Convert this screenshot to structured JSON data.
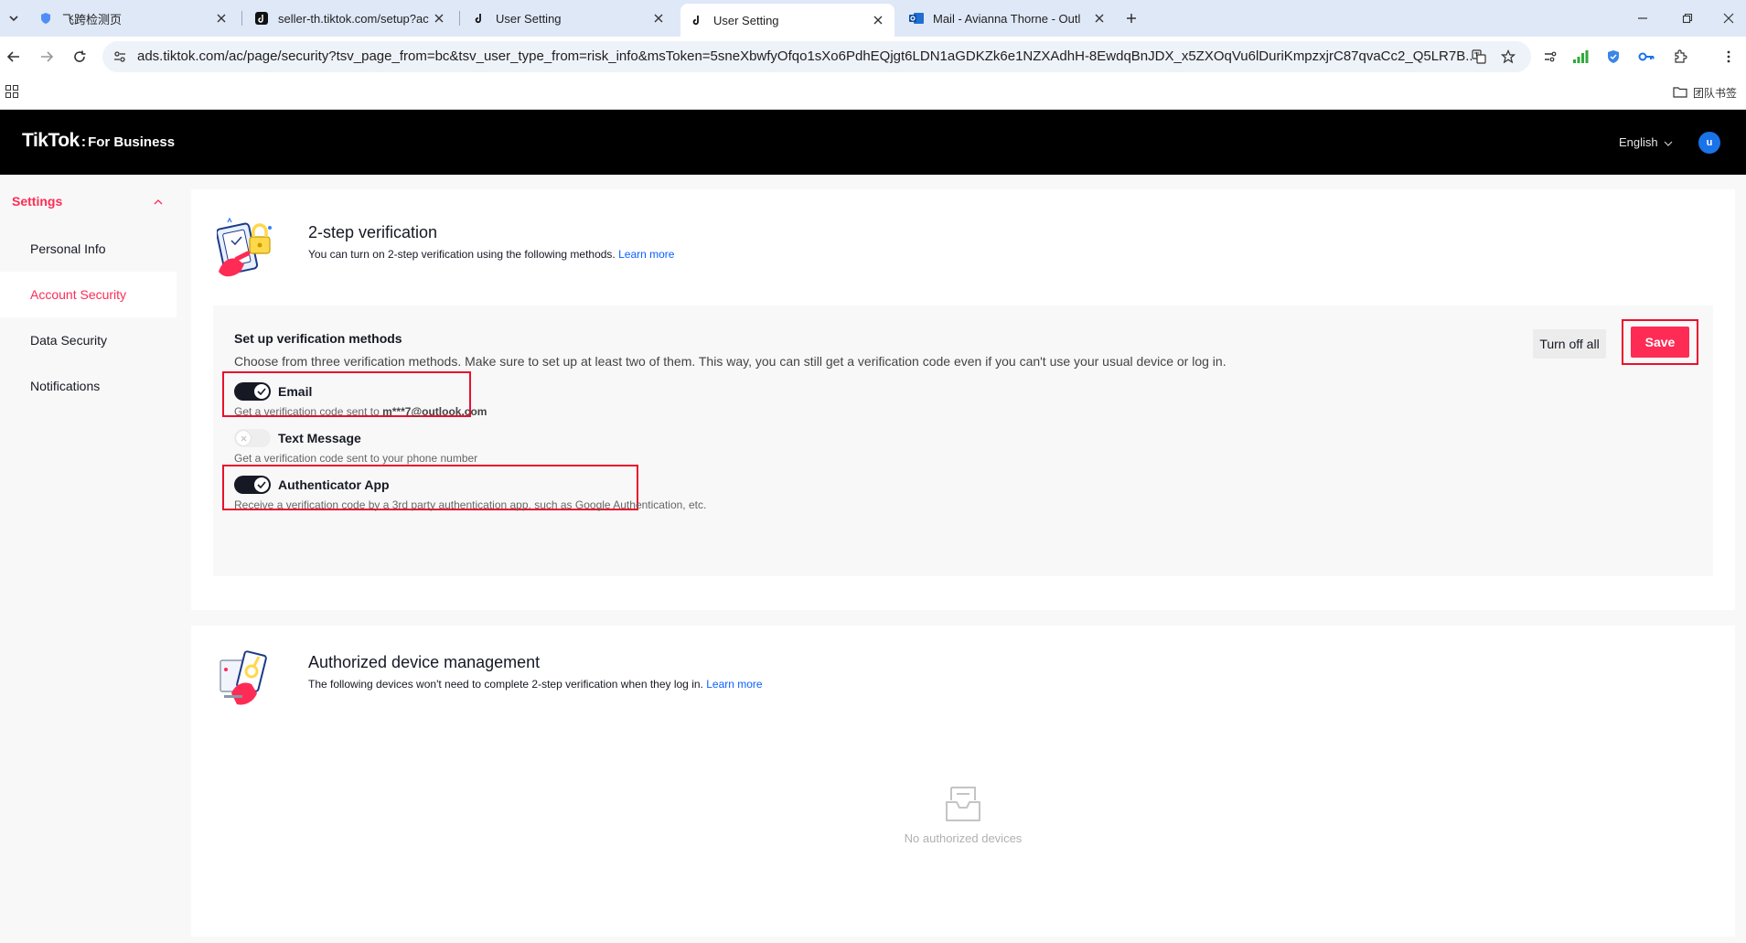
{
  "browser": {
    "tabs": [
      {
        "label": "飞跨检测页",
        "icon": "shield-favicon-icon",
        "active": false
      },
      {
        "label": "seller-th.tiktok.com/setup?ac",
        "icon": "tiktok-favicon-icon",
        "active": false
      },
      {
        "label": "User Setting",
        "icon": "tiktok-favicon-icon",
        "active": false
      },
      {
        "label": "User Setting",
        "icon": "tiktok-favicon-icon",
        "active": true
      },
      {
        "label": "Mail - Avianna Thorne - Outl",
        "icon": "outlook-favicon-icon",
        "active": false
      }
    ],
    "url": "ads.tiktok.com/ac/page/security?tsv_page_from=bc&tsv_user_type_from=risk_info&msToken=5sneXbwfyOfqo1sXo6PdhEQjgt6LDN1aGDKZk6e1NZXAdhH-8EwdqBnJDX_x5ZXOqVu6lDuriKmpzxjrC87qvaCc2_Q5LR7B...",
    "bookmark_folder": "团队书签"
  },
  "header": {
    "brand": "TikTok",
    "brand_sub": "For Business",
    "language": "English",
    "avatar_letter": "u"
  },
  "sidebar": {
    "title": "Settings",
    "items": [
      {
        "label": "Personal Info",
        "active": false
      },
      {
        "label": "Account Security",
        "active": true
      },
      {
        "label": "Data Security",
        "active": false
      },
      {
        "label": "Notifications",
        "active": false
      }
    ]
  },
  "two_step": {
    "title": "2-step verification",
    "desc": "You can turn on 2-step verification using the following methods.",
    "learn_more": "Learn more",
    "methods_title": "Set up verification methods",
    "methods_desc": "Choose from three verification methods. Make sure to set up at least two of them. This way, you can still get a verification code even if you can't use your usual device or log in.",
    "turn_off_all": "Turn off all",
    "save": "Save",
    "options": [
      {
        "label": "Email",
        "enabled": true,
        "desc": "Get a verification code sent to ",
        "desc_bold": "m***7@outlook.com"
      },
      {
        "label": "Text Message",
        "enabled": false,
        "desc": "Get a verification code sent to your phone number",
        "desc_bold": ""
      },
      {
        "label": "Authenticator App",
        "enabled": true,
        "desc": "Receive a verification code by a 3rd party authentication app, such as Google Authentication, etc.",
        "desc_bold": ""
      }
    ]
  },
  "devices": {
    "title": "Authorized device management",
    "desc": "The following devices won't need to complete 2-step verification when they log in.",
    "learn_more": "Learn more",
    "empty_text": "No authorized devices"
  },
  "colors": {
    "accent": "#fe2c55",
    "link": "#0b5fff",
    "highlight": "#e8112d",
    "header_bg": "#000000"
  }
}
